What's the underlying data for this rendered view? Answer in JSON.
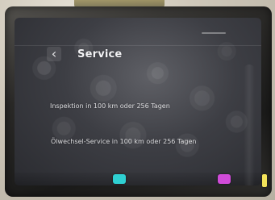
{
  "header": {
    "back_glyph": "‹",
    "title": "Service"
  },
  "service": {
    "items": [
      {
        "text": "Inspektion in 100 km oder 256 Tagen"
      },
      {
        "text": "Ölwechsel-Service in 100 km oder 256 Tagen"
      }
    ]
  },
  "colors": {
    "title_text": "#f2f2f4",
    "item_text": "#f5f5f7",
    "screen_bg": "#3d3e44",
    "accent_cyan": "#2fd0d2",
    "accent_magenta": "#d04bd8",
    "accent_yellow": "#f3e35a"
  },
  "icons": {
    "back": "chevron-left-icon",
    "dock_left": "app-icon",
    "dock_right": "app-icon"
  }
}
